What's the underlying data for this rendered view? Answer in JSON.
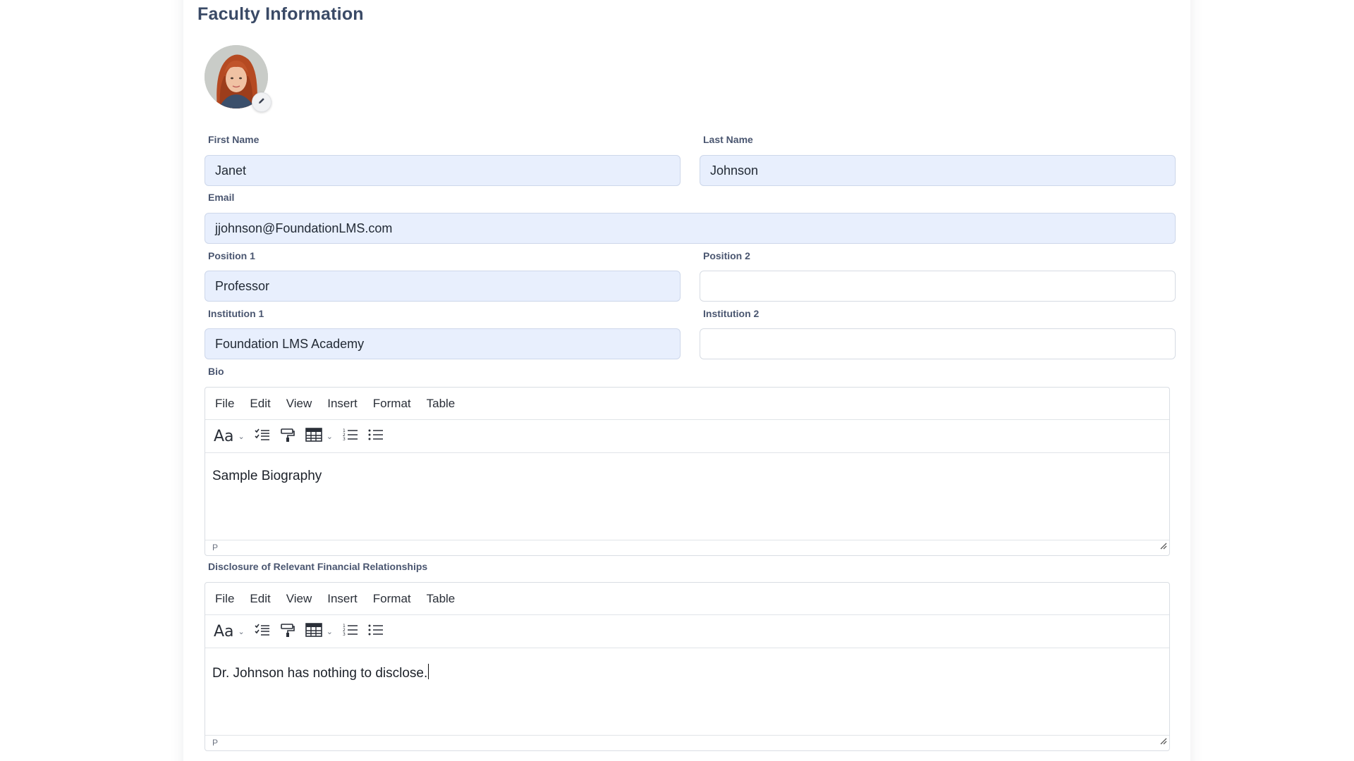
{
  "page": {
    "title": "Faculty Information"
  },
  "fields": {
    "first_name": {
      "label": "First Name",
      "value": "Janet"
    },
    "last_name": {
      "label": "Last Name",
      "value": "Johnson"
    },
    "email": {
      "label": "Email",
      "value": "jjohnson@FoundationLMS.com"
    },
    "position1": {
      "label": "Position 1",
      "value": "Professor"
    },
    "position2": {
      "label": "Position 2",
      "value": ""
    },
    "institution1": {
      "label": "Institution 1",
      "value": "Foundation LMS Academy"
    },
    "institution2": {
      "label": "Institution 2",
      "value": ""
    }
  },
  "bio": {
    "label": "Bio",
    "menu": [
      "File",
      "Edit",
      "View",
      "Insert",
      "Format",
      "Table"
    ],
    "content": "Sample Biography",
    "status": "P"
  },
  "disclosure": {
    "label": "Disclosure of Relevant Financial Relationships",
    "menu": [
      "File",
      "Edit",
      "View",
      "Insert",
      "Format",
      "Table"
    ],
    "content": "Dr. Johnson has nothing to disclose.",
    "status": "P"
  },
  "toolbar": {
    "font_size_glyph": "Aa"
  },
  "icons": {
    "avatar_edit": "pencil-icon",
    "tools": [
      "font-size-icon",
      "checklist-icon",
      "format-painter-icon",
      "table-icon",
      "numbered-list-icon",
      "bullet-list-icon"
    ]
  },
  "colors": {
    "title": "#3a4a66",
    "label": "#4a5670",
    "filled_input_bg": "#e8effd",
    "border": "#d6dbe3"
  }
}
